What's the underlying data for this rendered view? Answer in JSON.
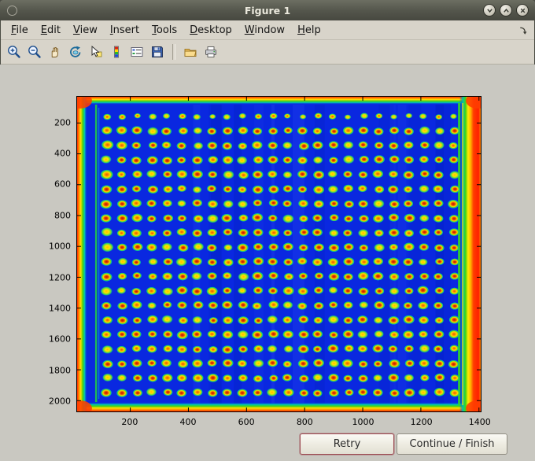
{
  "window": {
    "title": "Figure 1",
    "controls": [
      "minimize",
      "maximize",
      "close"
    ]
  },
  "menu_bar": {
    "items": [
      {
        "label": "File"
      },
      {
        "label": "Edit"
      },
      {
        "label": "View"
      },
      {
        "label": "Insert"
      },
      {
        "label": "Tools"
      },
      {
        "label": "Desktop"
      },
      {
        "label": "Window"
      },
      {
        "label": "Help"
      }
    ]
  },
  "toolbar": {
    "icons": [
      "zoom-in",
      "zoom-out",
      "pan-hand",
      "rotate-3d",
      "data-cursor",
      "insert-colorbar",
      "insert-legend",
      "save-figure",
      "open-folder",
      "print"
    ]
  },
  "figure": {
    "x_ticks": [
      200,
      400,
      600,
      800,
      1000,
      1200,
      1400
    ],
    "y_ticks": [
      200,
      400,
      600,
      800,
      1000,
      1200,
      1400,
      1600,
      1800,
      2000
    ],
    "x_domain": [
      17,
      1406
    ],
    "y_domain": [
      30,
      2070
    ],
    "image": {
      "type": "dot-array-heatmap",
      "description": "microplate-style grid of hot spots on blue background with hot red-orange edges",
      "rows": 20,
      "cols": 24,
      "background_color": "#0a28e0",
      "dot_core_color": "#c81800",
      "dot_ring_colors": [
        "#ff8800",
        "#ffd800",
        "#50c820",
        "#00b4c8"
      ],
      "border_colors": [
        "#ff2600",
        "#ff8c00",
        "#ffe000",
        "#44d014",
        "#00c8b4"
      ]
    }
  },
  "buttons": {
    "retry": "Retry",
    "continue": "Continue / Finish"
  }
}
